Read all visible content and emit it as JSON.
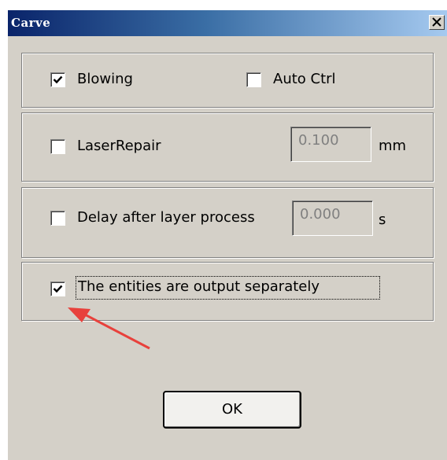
{
  "dialog": {
    "title": "Carve",
    "close_glyph": "✕"
  },
  "options": {
    "blowing": {
      "label": "Blowing",
      "checked": true
    },
    "auto_ctrl": {
      "label": "Auto Ctrl",
      "checked": false
    },
    "laser_repair": {
      "label": "LaserRepair",
      "checked": false,
      "value": "0.100",
      "unit": "mm"
    },
    "delay": {
      "label": "Delay after layer process",
      "checked": false,
      "value": "0.000",
      "unit": "s"
    },
    "entities": {
      "label": "The entities are output separately",
      "checked": true
    }
  },
  "buttons": {
    "ok_label": "OK"
  },
  "annotation": {
    "arrow_color": "#e8413c"
  }
}
